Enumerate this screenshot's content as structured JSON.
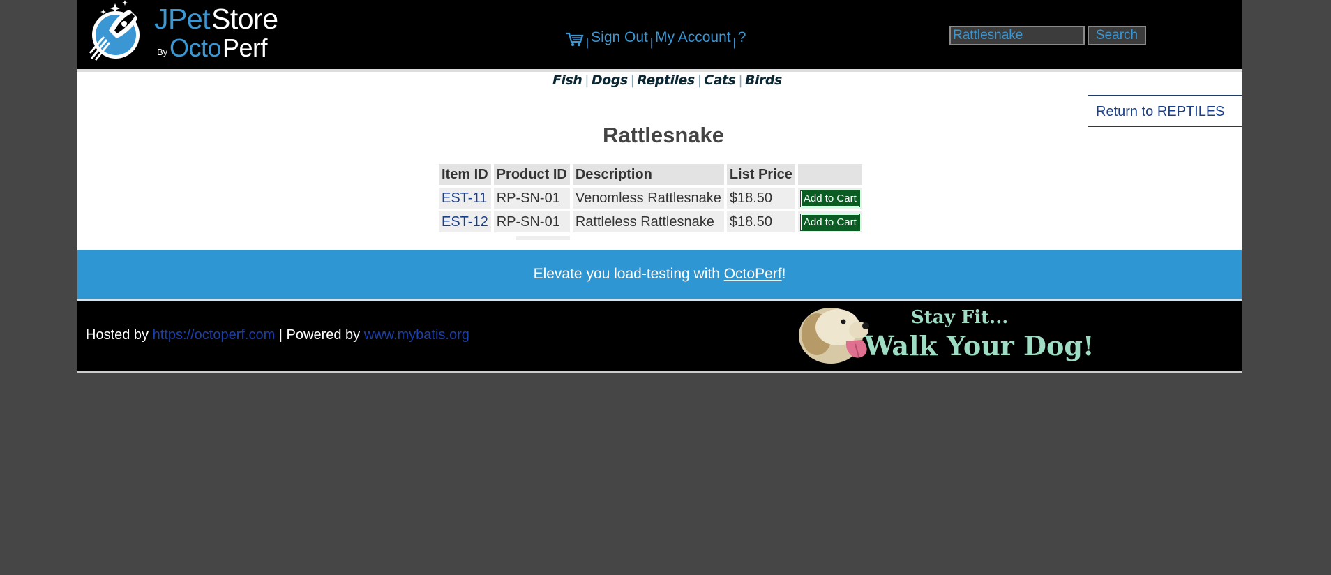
{
  "header": {
    "logo": {
      "part1": "JPet",
      "part2": "Store",
      "by": "By",
      "part3": "Octo",
      "part4": "Perf"
    },
    "menu": {
      "cart_icon": "shopping-cart-icon",
      "sep": "|",
      "sign_out": "Sign Out",
      "my_account": "My Account",
      "help": "?"
    },
    "search": {
      "value": "Rattlesnake",
      "button": "Search"
    }
  },
  "quicklinks": {
    "sep": "|",
    "items": [
      "Fish",
      "Dogs",
      "Reptiles",
      "Cats",
      "Birds"
    ]
  },
  "back_link": "Return to REPTILES",
  "catalog": {
    "title": "Rattlesnake",
    "headers": [
      "Item ID",
      "Product ID",
      "Description",
      "List Price",
      ""
    ],
    "rows": [
      {
        "item_id": "EST-11",
        "product_id": "RP-SN-01",
        "description": "Venomless Rattlesnake",
        "price": "$18.50",
        "action": "Add to Cart"
      },
      {
        "item_id": "EST-12",
        "product_id": "RP-SN-01",
        "description": "Rattleless Rattlesnake",
        "price": "$18.50",
        "action": "Add to Cart"
      }
    ]
  },
  "promo": {
    "before": "Elevate you load-testing with ",
    "link": "OctoPerf",
    "after": "!"
  },
  "footer": {
    "hosted_by": "Hosted by ",
    "hosted_link": "https://octoperf.com",
    "powered_by": " | Powered by ",
    "powered_link": "www.mybatis.org",
    "banner": {
      "line1": "Stay Fit...",
      "line2": "Walk Your Dog!"
    }
  },
  "colors": {
    "accent": "#3a97d4",
    "promo_bg": "#2e96d2",
    "cart_button": "#0a5c23",
    "link": "#1a3f8a"
  }
}
